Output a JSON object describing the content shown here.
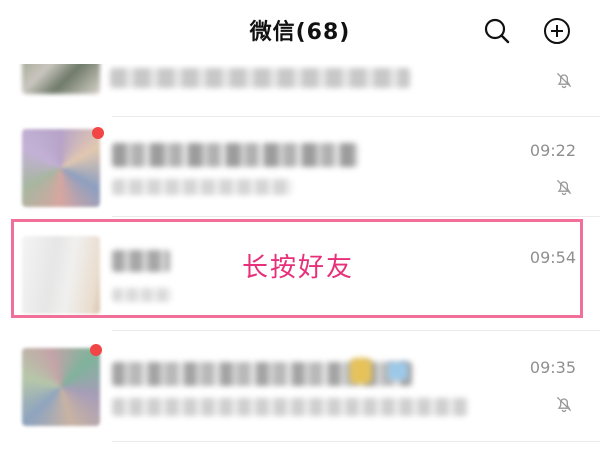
{
  "header": {
    "title": "微信(68)",
    "search_icon": "search-icon",
    "add_icon": "plus-circle-icon"
  },
  "chats": [
    {
      "time": "",
      "muted": true,
      "unread": false
    },
    {
      "time": "09:22",
      "muted": true,
      "unread": true
    },
    {
      "time": "09:54",
      "muted": false,
      "unread": false
    },
    {
      "time": "09:35",
      "muted": true,
      "unread": true
    }
  ],
  "annotation": {
    "text": "长按好友",
    "color": "#e8307a",
    "border_color": "#f0709a"
  }
}
